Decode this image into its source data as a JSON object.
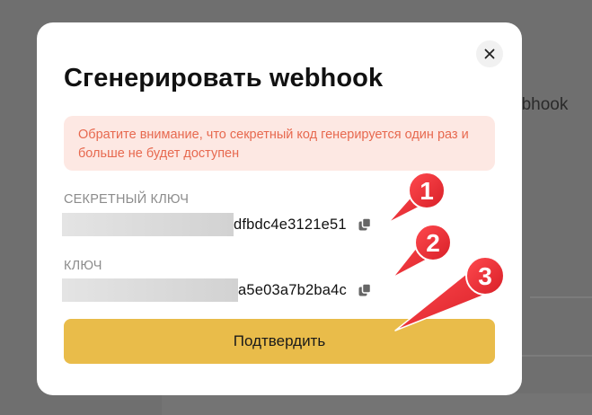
{
  "background": {
    "partial_text": "ebhook"
  },
  "modal": {
    "title": "Сгенерировать webhook",
    "notice": "Обратите внимание, что секретный код генерируется один раз и больше не будет доступен",
    "secret_key": {
      "label": "СЕКРЕТНЫЙ КЛЮЧ",
      "visible_value": "dfbdc4e3121e51"
    },
    "key": {
      "label": "КЛЮЧ",
      "visible_value": "a5e03a7b2ba4c"
    },
    "confirm_label": "Подтвердить",
    "close_icon": "close-icon",
    "copy_icon": "copy-icon"
  },
  "annotations": {
    "markers": [
      "1",
      "2",
      "3"
    ],
    "color": "#e8323a"
  },
  "colors": {
    "accent": "#e9bc4a",
    "notice_bg": "#fde8e3",
    "notice_text": "#e7694f"
  }
}
